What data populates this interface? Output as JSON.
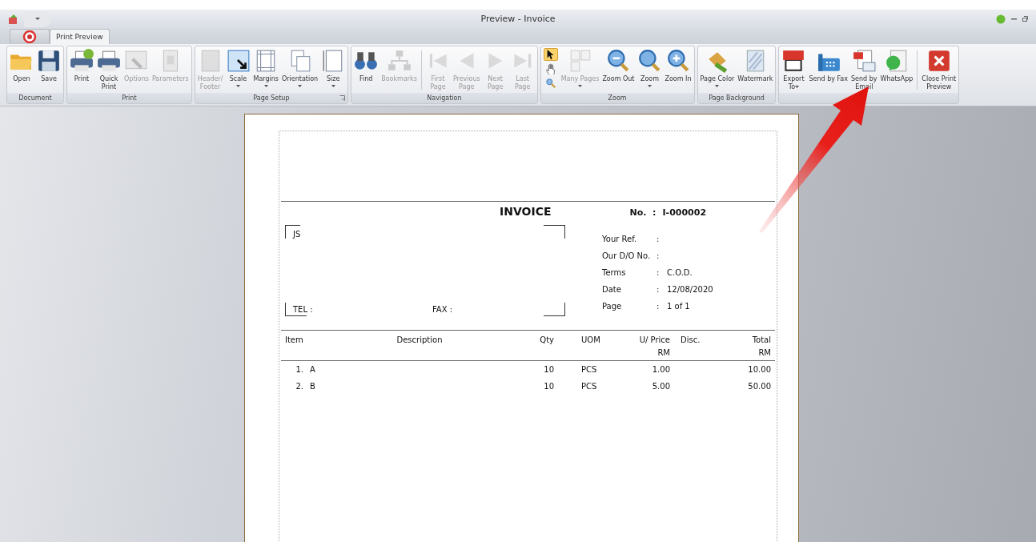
{
  "window": {
    "title": "Preview - Invoice"
  },
  "tabs": [
    {
      "label": "Print Preview",
      "selected": true
    }
  ],
  "ribbon": {
    "groups": [
      {
        "label": "Document",
        "buttons": [
          {
            "kind": "large",
            "label": "Open",
            "disabled": false
          },
          {
            "kind": "large",
            "label": "Save",
            "disabled": false
          }
        ]
      },
      {
        "label": "Print",
        "buttons": [
          {
            "kind": "large",
            "label": "Print",
            "disabled": false
          },
          {
            "kind": "large",
            "label": "Quick\nPrint",
            "disabled": false
          },
          {
            "kind": "large",
            "label": "Options",
            "disabled": true
          },
          {
            "kind": "large",
            "label": "Parameters",
            "disabled": true
          }
        ]
      },
      {
        "label": "Page Setup",
        "launcher": true,
        "buttons": [
          {
            "kind": "large",
            "label": "Header/\nFooter",
            "disabled": true
          },
          {
            "kind": "large",
            "label": "Scale",
            "disabled": false,
            "dropdown": true
          },
          {
            "kind": "large",
            "label": "Margins",
            "disabled": false,
            "dropdown": true
          },
          {
            "kind": "large",
            "label": "Orientation",
            "disabled": false,
            "dropdown": true
          },
          {
            "kind": "large",
            "label": "Size",
            "disabled": false,
            "dropdown": true
          }
        ]
      },
      {
        "label": "Navigation",
        "buttons": [
          {
            "kind": "large",
            "label": "Find",
            "disabled": false
          },
          {
            "kind": "large",
            "label": "Bookmarks",
            "disabled": true
          },
          {
            "kind": "large",
            "label": "First\nPage",
            "disabled": true,
            "separator_before": true
          },
          {
            "kind": "large",
            "label": "Previous\nPage",
            "disabled": true
          },
          {
            "kind": "large",
            "label": "Next\nPage",
            "disabled": true
          },
          {
            "kind": "large",
            "label": "Last\nPage",
            "disabled": true
          }
        ]
      },
      {
        "label": "Zoom",
        "buttons": [
          {
            "kind": "tools",
            "tools": [
              {
                "selected": true
              },
              {
                "selected": false
              },
              {
                "selected": false
              }
            ]
          },
          {
            "kind": "large",
            "label": "Many Pages",
            "disabled": true,
            "dropdown": true
          },
          {
            "kind": "large",
            "label": "Zoom Out",
            "disabled": false
          },
          {
            "kind": "large",
            "label": "Zoom",
            "disabled": false,
            "dropdown": true
          },
          {
            "kind": "large",
            "label": "Zoom In",
            "disabled": false
          }
        ]
      },
      {
        "label": "Page Background",
        "buttons": [
          {
            "kind": "large",
            "label": "Page Color",
            "disabled": false,
            "dropdown": true
          },
          {
            "kind": "large",
            "label": "Watermark",
            "disabled": false
          }
        ]
      },
      {
        "buttons": [
          {
            "kind": "large",
            "label": "Export\nTo",
            "disabled": false,
            "dropdown_inline": true
          },
          {
            "kind": "large",
            "label": "Send by Fax",
            "disabled": false
          },
          {
            "kind": "large",
            "label": "Send by\nEmail",
            "disabled": false
          },
          {
            "kind": "large",
            "label": "WhatsApp",
            "disabled": false
          },
          {
            "kind": "large",
            "label": "Close Print\nPreview",
            "disabled": false,
            "separator_before": true
          }
        ]
      }
    ]
  },
  "invoice": {
    "title": "INVOICE",
    "number_label": "No.  :",
    "number": "I-000002",
    "customer": "JS",
    "tel_label": "TEL :",
    "fax_label": "FAX :",
    "info": [
      {
        "label": "Your Ref.",
        "separator": ":"
      },
      {
        "label": "Our D/O No.",
        "separator": ":"
      },
      {
        "label": "Terms",
        "separator": ":",
        "value": "C.O.D."
      },
      {
        "label": "Date",
        "separator": ":",
        "value": "12/08/2020"
      },
      {
        "label": "Page",
        "separator": ":",
        "value": "1 of 1"
      }
    ],
    "columns": {
      "item": "Item",
      "description": "Description",
      "qty": "Qty",
      "uom": "UOM",
      "price": "U/ Price",
      "price_unit": "RM",
      "disc": "Disc.",
      "total": "Total",
      "total_unit": "RM"
    },
    "rows": [
      {
        "number": "1.",
        "item": "A",
        "qty": "10",
        "uom": "PCS",
        "price": "1.00",
        "total": "10.00"
      },
      {
        "number": "2.",
        "item": "B",
        "qty": "10",
        "uom": "PCS",
        "price": "5.00",
        "total": "50.00"
      }
    ]
  }
}
